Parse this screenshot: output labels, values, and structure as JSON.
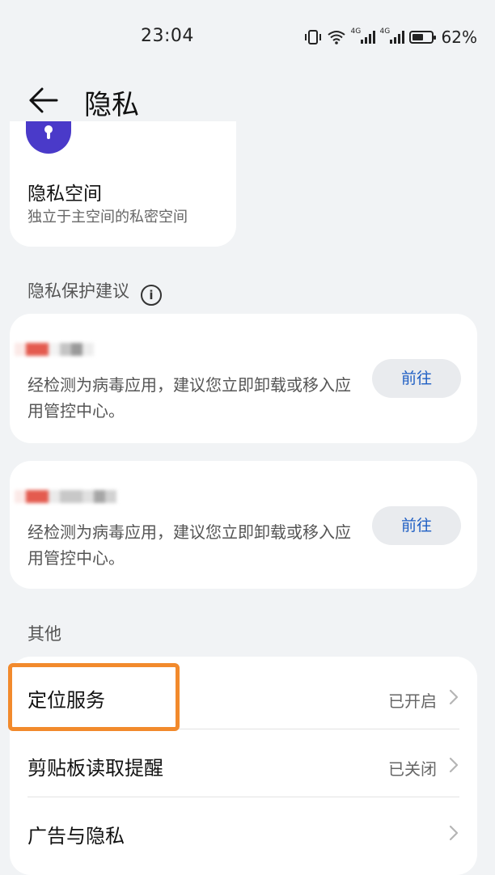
{
  "status_bar": {
    "time": "23:04",
    "battery_percent": "62%",
    "battery_level": 0.62,
    "icons": [
      "vibrate-icon",
      "wifi-icon",
      "signal-4g-icon",
      "signal-4g-icon",
      "battery-icon"
    ],
    "network_tags": [
      "4G",
      "4G"
    ]
  },
  "header": {
    "title": "隐私",
    "back_icon": "arrow-left-icon"
  },
  "privacy_space": {
    "icon": "shield-lock-icon",
    "icon_color": "#4a3ac9",
    "title": "隐私空间",
    "description": "独立于主空间的私密空间"
  },
  "suggestions": {
    "section_title": "隐私保护建议",
    "info_icon": "info-icon",
    "items": [
      {
        "app_name": "",
        "text": "经检测为病毒应用，建议您立即卸载或移入应用管控中心。",
        "button": "前往"
      },
      {
        "app_name": "",
        "text": "经检测为病毒应用，建议您立即卸载或移入应用管控中心。",
        "button": "前往"
      }
    ]
  },
  "other": {
    "section_title": "其他",
    "items": [
      {
        "label": "定位服务",
        "value": "已开启"
      },
      {
        "label": "剪贴板读取提醒",
        "value": "已关闭"
      },
      {
        "label": "广告与隐私",
        "value": ""
      }
    ]
  },
  "colors": {
    "accent": "#1f5fc4",
    "highlight": "#f28a2c",
    "background": "#f1f3f5"
  }
}
